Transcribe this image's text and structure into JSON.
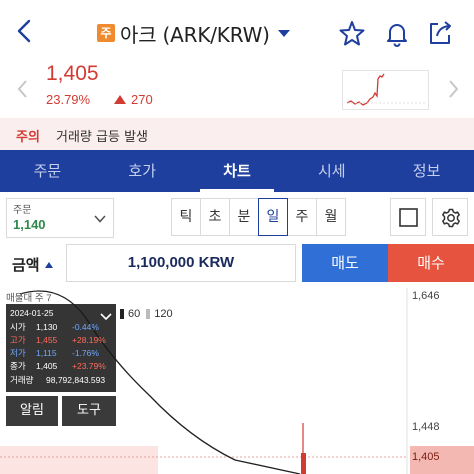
{
  "header": {
    "badge": "주",
    "title": "아크 (ARK/KRW)"
  },
  "quote": {
    "price": "1,405",
    "change_pct": "23.79%",
    "change_abs": "270"
  },
  "warning": {
    "label": "주의",
    "text": "거래량 급등 발생"
  },
  "tabs": [
    {
      "label": "주문",
      "active": false
    },
    {
      "label": "호가",
      "active": false
    },
    {
      "label": "차트",
      "active": true
    },
    {
      "label": "시세",
      "active": false
    },
    {
      "label": "정보",
      "active": false
    }
  ],
  "order_type": {
    "label": "주문",
    "value": "1,140"
  },
  "periods": [
    "틱",
    "초",
    "분",
    "일",
    "주",
    "월"
  ],
  "active_period": "일",
  "amount": {
    "label": "금액",
    "value": "1,100,000 KRW",
    "sell_label": "매도",
    "buy_label": "매수"
  },
  "chart_header": {
    "ma_label": "매물대 주 7",
    "ma60": "60",
    "ma120": "120"
  },
  "chart_data": {
    "type": "candlestick",
    "y_ticks": [
      "1,646",
      "1,448"
    ],
    "current_price_label": "1,405",
    "ma_line_color": "#222222"
  },
  "tooltip": {
    "date": "2024-01-25",
    "rows": [
      {
        "label": "시가",
        "value": "1,130",
        "pct": "-0.44%",
        "color": "#6fa8ff"
      },
      {
        "label": "고가",
        "value": "1,455",
        "pct": "+28.19%",
        "color": "#ff6b5a"
      },
      {
        "label": "저가",
        "value": "1,115",
        "pct": "-1.76%",
        "color": "#6fa8ff"
      },
      {
        "label": "종가",
        "value": "1,405",
        "pct": "+23.79%",
        "color": "#ff6b5a"
      }
    ],
    "volume_label": "거래량",
    "volume_value": "98,792,843.593"
  },
  "bottom_buttons": {
    "alert": "알림",
    "tools": "도구"
  },
  "colors": {
    "brand_blue": "#1f3f9f",
    "up_red": "#d23b33",
    "down_blue": "#2f6fd6",
    "ju_badge": "#f08a2e"
  }
}
